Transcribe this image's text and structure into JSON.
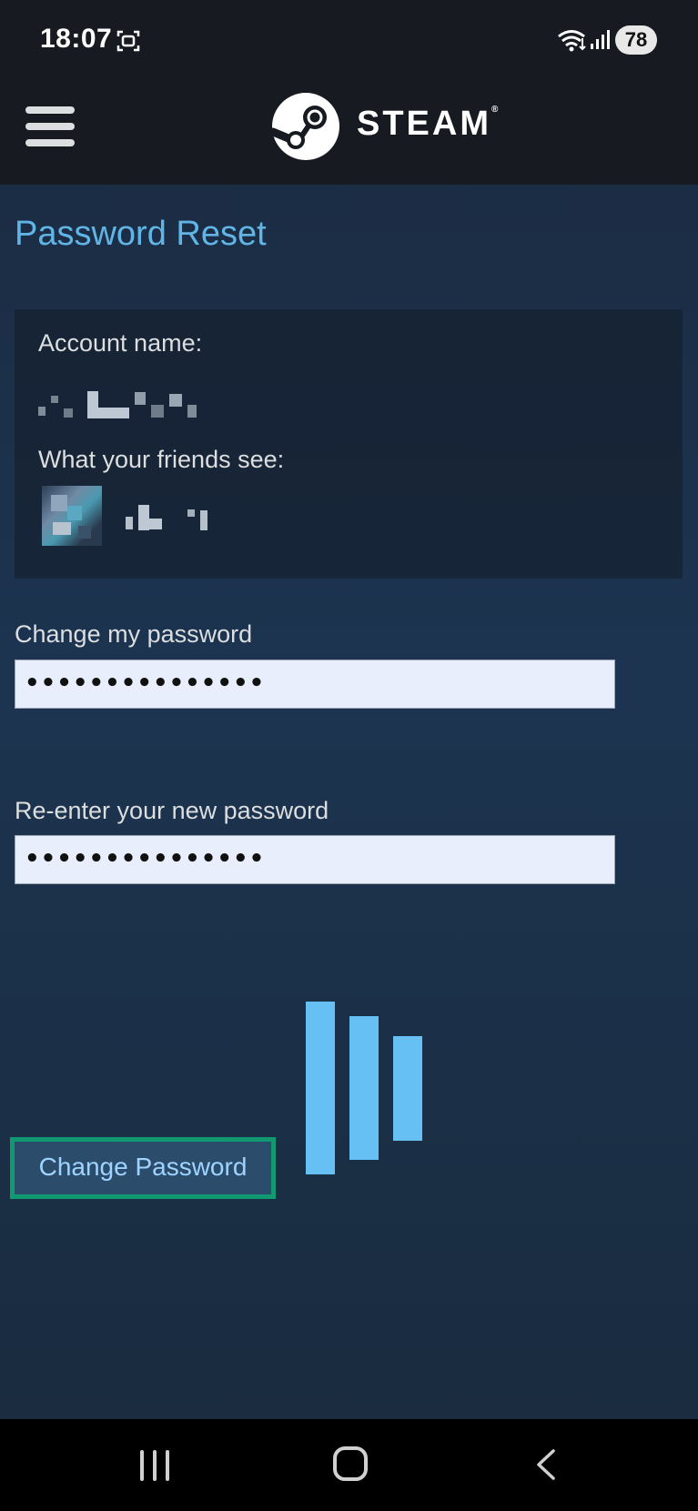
{
  "status_bar": {
    "time": "18:07",
    "battery": "78",
    "icons": [
      "screen-record-icon",
      "wifi-icon",
      "signal-icon"
    ]
  },
  "header": {
    "brand": "STEAM",
    "registered_mark": "®",
    "icons": [
      "menu-icon",
      "steam-logo-icon"
    ]
  },
  "page": {
    "title": "Password Reset"
  },
  "account_panel": {
    "account_name_label": "Account name:",
    "friends_label": "What your friends see:"
  },
  "form": {
    "new_password_label": "Change my password",
    "new_password_value": "•••••••••••••••",
    "reenter_label": "Re-enter your new password",
    "reenter_value": "•••••••••••••••",
    "submit_label": "Change Password"
  },
  "nav_bar": {
    "icons": [
      "recent-apps-icon",
      "home-icon",
      "back-icon"
    ]
  },
  "colors": {
    "accent": "#66c0f4",
    "header_bg": "#171a21",
    "focus_outline": "#119a72"
  }
}
